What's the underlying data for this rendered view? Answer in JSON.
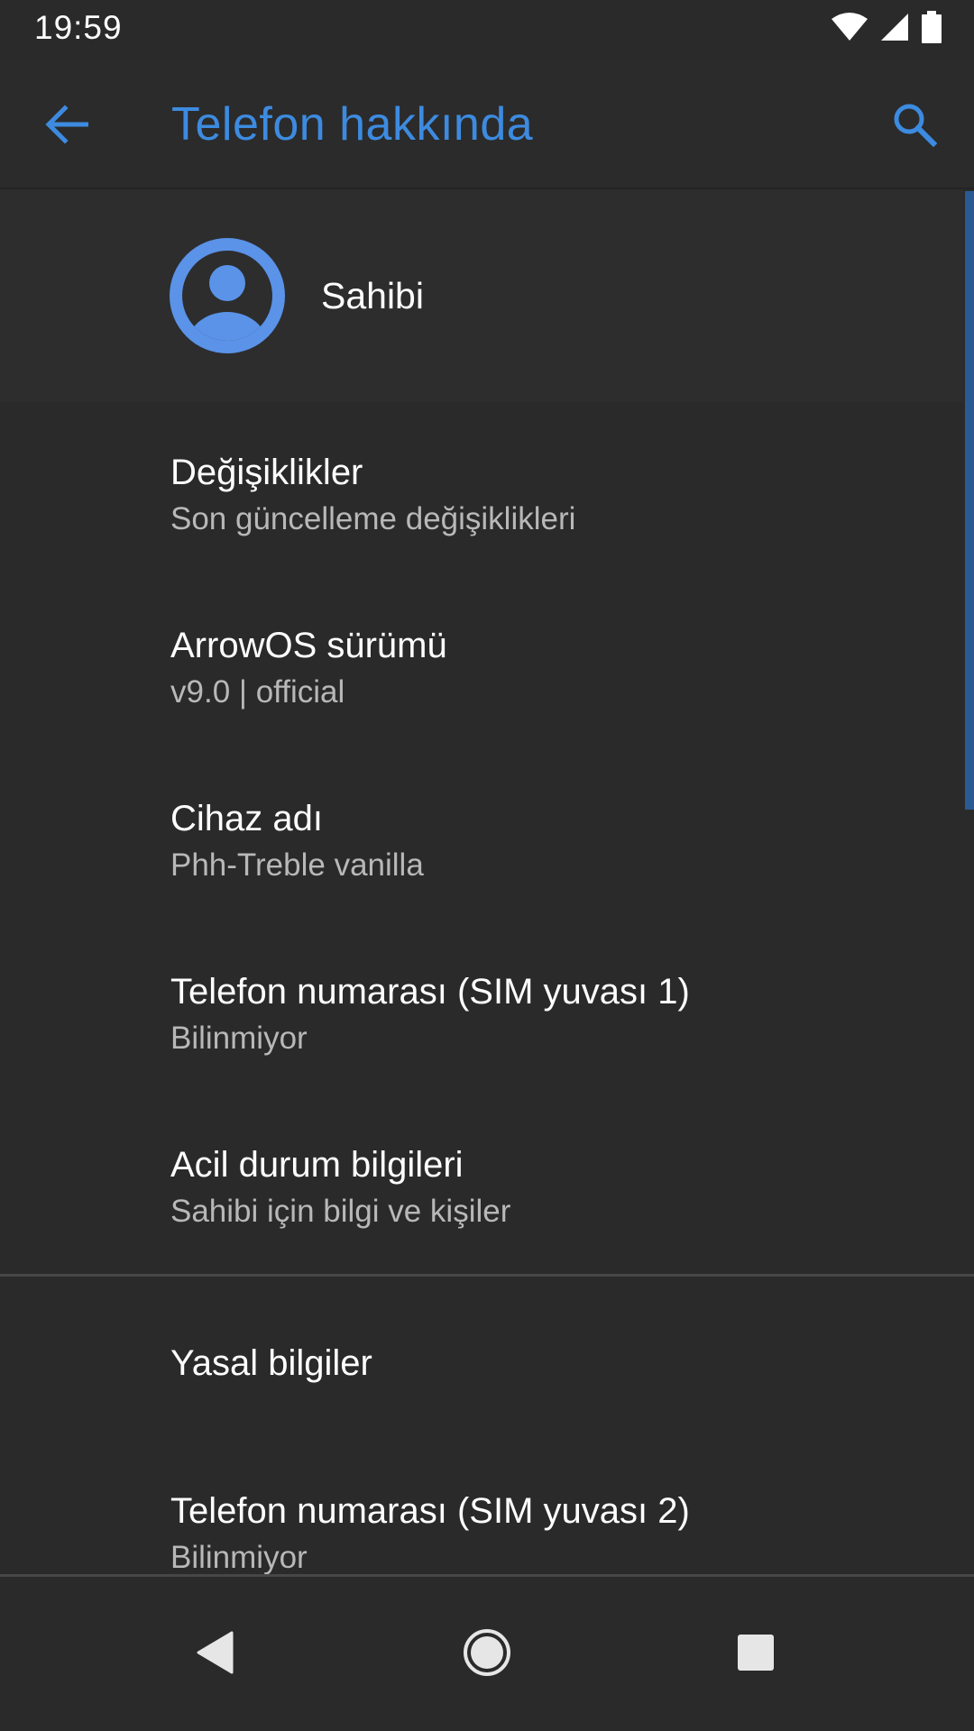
{
  "status_bar": {
    "time": "19:59",
    "icons": [
      "wifi-icon",
      "cell-signal-icon",
      "battery-icon"
    ]
  },
  "app_bar": {
    "title": "Telefon hakkında",
    "back_icon": "arrow-back-icon",
    "search_icon": "search-icon"
  },
  "owner": {
    "label": "Sahibi",
    "icon": "account-circle-icon"
  },
  "preferences": [
    {
      "title": "Değişiklikler",
      "summary": "Son güncelleme değişiklikleri"
    },
    {
      "title": "ArrowOS sürümü",
      "summary": "v9.0 | official"
    },
    {
      "title": "Cihaz adı",
      "summary": "Phh-Treble vanilla"
    },
    {
      "title": "Telefon numarası (SIM yuvası 1)",
      "summary": "Bilinmiyor"
    },
    {
      "title": "Acil durum bilgileri",
      "summary": "Sahibi için bilgi ve kişiler"
    },
    {
      "title": "Yasal bilgiler"
    },
    {
      "title": "Telefon numarası (SIM yuvası 2)",
      "summary": "Bilinmiyor"
    }
  ],
  "nav_bar": {
    "icons": [
      "back-triangle-icon",
      "home-circle-icon",
      "recents-square-icon"
    ]
  },
  "colors": {
    "accent": "#3d8be0",
    "background": "#2a2a2b",
    "avatar": "#5a93e8",
    "summary_text": "#b8b8b8"
  }
}
